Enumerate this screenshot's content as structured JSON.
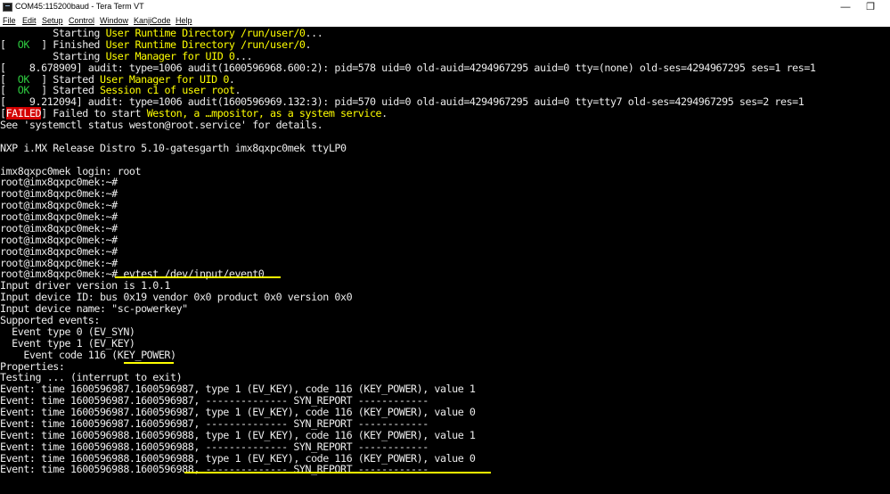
{
  "window": {
    "title": "COM45:115200baud - Tera Term VT",
    "min_glyph": "—",
    "restore_glyph": "❐"
  },
  "menu": [
    "File",
    "Edit",
    "Setup",
    "Control",
    "Window",
    "KanjiCode",
    "Help"
  ],
  "terminal": {
    "lines": [
      [
        {
          "t": "         Starting "
        },
        {
          "t": "User Runtime Directory /run/user/0",
          "c": "y"
        },
        {
          "t": "..."
        }
      ],
      [
        {
          "t": "["
        },
        {
          "t": "  OK  ",
          "c": "g"
        },
        {
          "t": "] Finished "
        },
        {
          "t": "User Runtime Directory /run/user/0",
          "c": "y"
        },
        {
          "t": "."
        }
      ],
      [
        {
          "t": "         Starting "
        },
        {
          "t": "User Manager for UID 0",
          "c": "y"
        },
        {
          "t": "..."
        }
      ],
      [
        {
          "t": "[    8.678909] audit: type=1006 audit(1600596968.600:2): pid=578 uid=0 old-auid=4294967295 auid=0 tty=(none) old-ses=4294967295 ses=1 res=1"
        }
      ],
      [
        {
          "t": "["
        },
        {
          "t": "  OK  ",
          "c": "g"
        },
        {
          "t": "] Started "
        },
        {
          "t": "User Manager for UID 0",
          "c": "y"
        },
        {
          "t": "."
        }
      ],
      [
        {
          "t": "["
        },
        {
          "t": "  OK  ",
          "c": "g"
        },
        {
          "t": "] Started "
        },
        {
          "t": "Session c1 of user root",
          "c": "y"
        },
        {
          "t": "."
        }
      ],
      [
        {
          "t": "[    9.212094] audit: type=1006 audit(1600596969.132:3): pid=570 uid=0 old-auid=4294967295 auid=0 tty=tty7 old-ses=4294967295 ses=2 res=1"
        }
      ],
      [
        {
          "t": "["
        },
        {
          "t": "FAILED",
          "c": "r"
        },
        {
          "t": "] Failed to start "
        },
        {
          "t": "Weston, a …mpositor, as a system service",
          "c": "y"
        },
        {
          "t": "."
        }
      ],
      [
        {
          "t": "See 'systemctl status weston@root.service' for details."
        }
      ],
      [
        {
          "t": ""
        }
      ],
      [
        {
          "t": "NXP i.MX Release Distro 5.10-gatesgarth imx8qxpc0mek ttyLP0"
        }
      ],
      [
        {
          "t": ""
        }
      ],
      [
        {
          "t": "imx8qxpc0mek login: root"
        }
      ],
      [
        {
          "t": "root@imx8qxpc0mek:~#"
        }
      ],
      [
        {
          "t": "root@imx8qxpc0mek:~#"
        }
      ],
      [
        {
          "t": "root@imx8qxpc0mek:~#"
        }
      ],
      [
        {
          "t": "root@imx8qxpc0mek:~#"
        }
      ],
      [
        {
          "t": "root@imx8qxpc0mek:~#"
        }
      ],
      [
        {
          "t": "root@imx8qxpc0mek:~#"
        }
      ],
      [
        {
          "t": "root@imx8qxpc0mek:~#"
        }
      ],
      [
        {
          "t": "root@imx8qxpc0mek:~#"
        }
      ],
      [
        {
          "t": "root@imx8qxpc0mek:~# evtest /dev/input/event0"
        }
      ],
      [
        {
          "t": "Input driver version is 1.0.1"
        }
      ],
      [
        {
          "t": "Input device ID: bus 0x19 vendor 0x0 product 0x0 version 0x0"
        }
      ],
      [
        {
          "t": "Input device name: \"sc-powerkey\""
        }
      ],
      [
        {
          "t": "Supported events:"
        }
      ],
      [
        {
          "t": "  Event type 0 (EV_SYN)"
        }
      ],
      [
        {
          "t": "  Event type 1 (EV_KEY)"
        }
      ],
      [
        {
          "t": "    Event code 116 (KEY_POWER)"
        }
      ],
      [
        {
          "t": "Properties:"
        }
      ],
      [
        {
          "t": "Testing ... (interrupt to exit)"
        }
      ],
      [
        {
          "t": "Event: time 1600596987.1600596987, type 1 (EV_KEY), code 116 (KEY_POWER), value 1"
        }
      ],
      [
        {
          "t": "Event: time 1600596987.1600596987, -------------- SYN_REPORT ------------"
        }
      ],
      [
        {
          "t": "Event: time 1600596987.1600596987, type 1 (EV_KEY), code 116 (KEY_POWER), value 0"
        }
      ],
      [
        {
          "t": "Event: time 1600596987.1600596987, -------------- SYN_REPORT ------------"
        }
      ],
      [
        {
          "t": "Event: time 1600596988.1600596988, type 1 (EV_KEY), code 116 (KEY_POWER), value 1"
        }
      ],
      [
        {
          "t": "Event: time 1600596988.1600596988, -------------- SYN_REPORT ------------"
        }
      ],
      [
        {
          "t": "Event: time 1600596988.1600596988, type 1 (EV_KEY), code 116 (KEY_POWER), value 0"
        }
      ],
      [
        {
          "t": "Event: time 1600596988.1600596988, -------------- SYN_REPORT ------------"
        }
      ]
    ]
  },
  "colors": {
    "terminal_bg": "#000000",
    "terminal_fg": "#ececec",
    "ok_green": "#2ecc40",
    "highlight_yellow": "#ffff00",
    "failed_red": "#d40000",
    "annotation_underline": "#ffff00"
  }
}
